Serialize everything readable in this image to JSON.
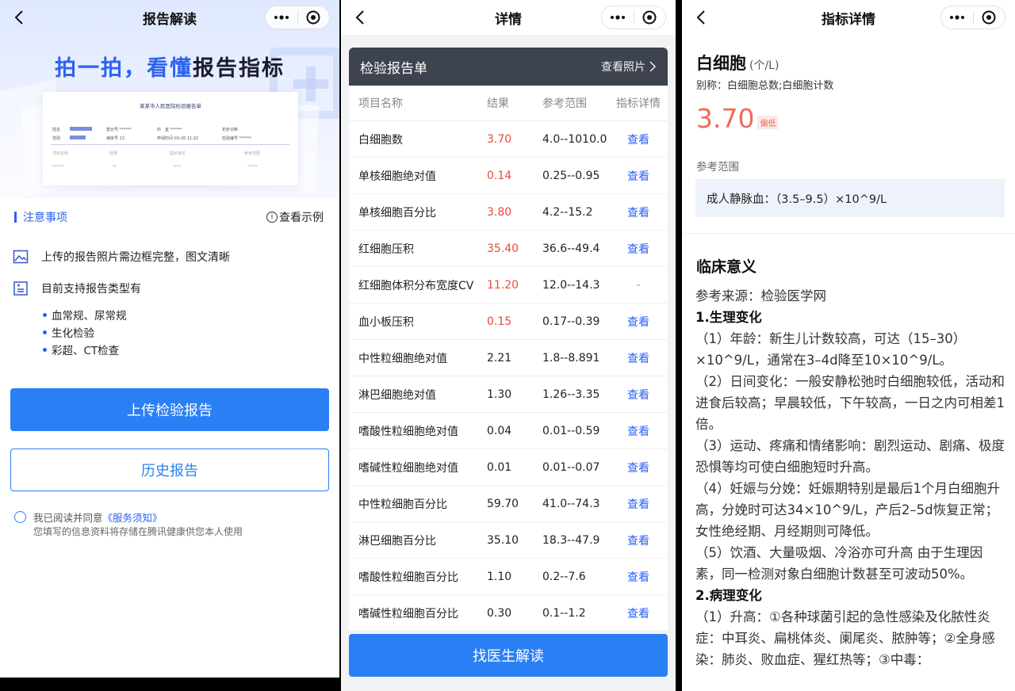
{
  "panel1": {
    "nav_title": "报告解读",
    "hero_title_part1": "拍一拍，看懂",
    "hero_title_part2": "报告指标",
    "sample_report": {
      "title": "某某市人民医院检验报告单",
      "row1": [
        "姓名",
        "登记号 ******",
        "科　室 ******",
        "初步诊断"
      ],
      "row2": [
        "性别",
        "病房号 13",
        "申请时间 03-26 11:22",
        "检验编号 ******"
      ],
      "row3": [
        "项目名称",
        "结果",
        "提示单位",
        "参考范围"
      ],
      "row4": [
        "******",
        "**",
        "****",
        "*****"
      ]
    },
    "notice_label": "注意事项",
    "example_link": "查看示例",
    "tip1": "上传的报告照片需边框完整，图文清晰",
    "tip2": "目前支持报告类型有",
    "report_types": [
      "血常规、尿常规",
      "生化检验",
      "彩超、CT检查"
    ],
    "upload_button": "上传检验报告",
    "history_button": "历史报告",
    "agree_text": "我已阅读并同意",
    "agree_link": "《服务须知》",
    "storage_note": "您填写的信息资料将存储在腾讯健康供您本人使用"
  },
  "panel2": {
    "nav_title": "详情",
    "table_title": "检验报告单",
    "view_photo": "查看照片",
    "columns": [
      "项目名称",
      "结果",
      "参考范围",
      "指标详情"
    ],
    "rows": [
      {
        "name": "白细胞数",
        "value": "3.70",
        "range": "4.0--1010.0",
        "action": "查看",
        "low": true
      },
      {
        "name": "单核细胞绝对值",
        "value": "0.14",
        "range": "0.25--0.95",
        "action": "查看",
        "low": true
      },
      {
        "name": "单核细胞百分比",
        "value": "3.80",
        "range": "4.2--15.2",
        "action": "查看",
        "low": true
      },
      {
        "name": "红细胞压积",
        "value": "35.40",
        "range": "36.6--49.4",
        "action": "查看",
        "low": true
      },
      {
        "name": "红细胞体积分布宽度CV",
        "value": "11.20",
        "range": "12.0--14.3",
        "action": "-",
        "low": true
      },
      {
        "name": "血小板压积",
        "value": "0.15",
        "range": "0.17--0.39",
        "action": "查看",
        "low": true
      },
      {
        "name": "中性粒细胞绝对值",
        "value": "2.21",
        "range": "1.8--8.891",
        "action": "查看",
        "low": false
      },
      {
        "name": "淋巴细胞绝对值",
        "value": "1.30",
        "range": "1.26--3.35",
        "action": "查看",
        "low": false
      },
      {
        "name": "嗜酸性粒细胞绝对值",
        "value": "0.04",
        "range": "0.01--0.59",
        "action": "查看",
        "low": false
      },
      {
        "name": "嗜碱性粒细胞绝对值",
        "value": "0.01",
        "range": "0.01--0.07",
        "action": "查看",
        "low": false
      },
      {
        "name": "中性粒细胞百分比",
        "value": "59.70",
        "range": "41.0--74.3",
        "action": "查看",
        "low": false
      },
      {
        "name": "淋巴细胞百分比",
        "value": "35.10",
        "range": "18.3--47.9",
        "action": "查看",
        "low": false
      },
      {
        "name": "嗜酸性粒细胞百分比",
        "value": "1.10",
        "range": "0.2--7.6",
        "action": "查看",
        "low": false
      },
      {
        "name": "嗜碱性粒细胞百分比",
        "value": "0.30",
        "range": "0.1--1.2",
        "action": "查看",
        "low": false
      }
    ],
    "doctor_button": "找医生解读"
  },
  "panel3": {
    "nav_title": "指标详情",
    "indicator_name": "白细胞",
    "indicator_unit": "(个/L)",
    "alias": "别称：白细胞总数;白细胞计数",
    "value": "3.70",
    "status_badge": "偏低",
    "ref_label": "参考范围",
    "ref_value": "成人静脉血：（3.5–9.5）×10^9/L",
    "section_title": "临床意义",
    "source": "参考来源：检验医学网",
    "h1": "1.生理变化",
    "p1": "（1）年龄：新生儿计数较高，可达（15–30）×10^9/L，通常在3–4d降至10×10^9/L。",
    "p2": "（2）日间变化：一般安静松弛时白细胞较低，活动和进食后较高；早晨较低，下午较高，一日之内可相差1倍。",
    "p3": "（3）运动、疼痛和情绪影响：剧烈运动、剧痛、极度恐惧等均可使白细胞短时升高。",
    "p4": "（4）妊娠与分娩：妊娠期特别是最后1个月白细胞升高，分娩时可达34×10^9/L，产后2–5d恢复正常；女性绝经期、月经期则可降低。",
    "p5": "（5）饮酒、大量吸烟、冷浴亦可升高 由于生理因素，同一检测对象白细胞计数甚至可波动50%。",
    "h2": "2.病理变化",
    "p6": "（1）升高：①各种球菌引起的急性感染及化脓性炎症：中耳炎、扁桃体炎、阑尾炎、脓肿等；②全身感染：肺炎、败血症、猩红热等；③中毒："
  },
  "colors": {
    "accent": "#2b7ff5",
    "low_value": "#e84a3c",
    "table_header_bg": "#3d434f"
  }
}
